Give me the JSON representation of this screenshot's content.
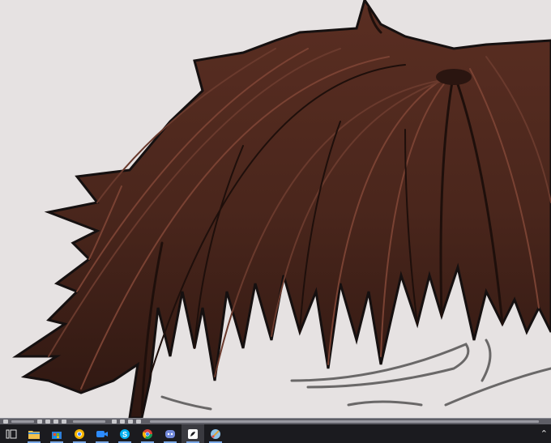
{
  "canvas": {
    "background": "#e6e2e2",
    "hair_base": "#3b1f17",
    "hair_mid": "#5a2e22",
    "hair_highlight": "#7a4233",
    "lineart": "#1a1a1a"
  },
  "statusbar": {
    "background": "#5e5e66"
  },
  "taskbar": {
    "background": "#1b1b1f",
    "items": [
      {
        "name": "task-view-icon",
        "color": "#e6e6e6"
      },
      {
        "name": "file-explorer-icon",
        "color": "#f2c14e"
      },
      {
        "name": "store-icon",
        "color": "#2f7fd6"
      },
      {
        "name": "browser-icon",
        "color": "#f4b400"
      },
      {
        "name": "zoom-icon",
        "color": "#2d8cff"
      },
      {
        "name": "skype-icon",
        "color": "#00aff0"
      },
      {
        "name": "chrome-icon",
        "color": "#db4437"
      },
      {
        "name": "discord-icon",
        "color": "#7289da"
      },
      {
        "name": "paint-app-icon",
        "color": "#ffffff"
      },
      {
        "name": "krita-icon",
        "color": "#8ec3e8"
      }
    ],
    "tray_chevron": "⌃"
  }
}
